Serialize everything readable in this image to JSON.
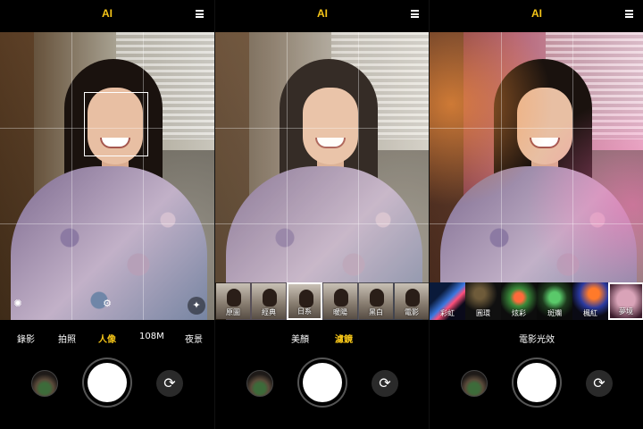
{
  "screens": [
    {
      "ai_label": "AI",
      "menu_icon": "menu-icon",
      "modes": [
        {
          "label": "錄影",
          "active": false
        },
        {
          "label": "拍照",
          "active": false
        },
        {
          "label": "人像",
          "active": true
        },
        {
          "label": "108M",
          "active": false
        },
        {
          "label": "夜景",
          "active": false
        }
      ],
      "icons": [
        "aperture-icon",
        "settings-icon",
        "flash-auto-icon"
      ]
    },
    {
      "ai_label": "AI",
      "menu_icon": "menu-icon",
      "filters": [
        {
          "label": "原圖",
          "selected": false
        },
        {
          "label": "經典",
          "selected": false
        },
        {
          "label": "日系",
          "selected": true
        },
        {
          "label": "暖陽",
          "selected": false
        },
        {
          "label": "黑白",
          "selected": false
        },
        {
          "label": "電影",
          "selected": false
        }
      ],
      "modes": [
        {
          "label": "美顏",
          "active": false
        },
        {
          "label": "濾鏡",
          "active": true
        }
      ]
    },
    {
      "ai_label": "AI",
      "menu_icon": "menu-icon",
      "flares": [
        {
          "label": "彩虹",
          "selected": false
        },
        {
          "label": "圓環",
          "selected": false
        },
        {
          "label": "炫彩",
          "selected": false
        },
        {
          "label": "斑斕",
          "selected": false
        },
        {
          "label": "楓紅",
          "selected": false
        },
        {
          "label": "夢境",
          "selected": true
        }
      ],
      "modes": [
        {
          "label": "電影光效",
          "active": true
        }
      ]
    }
  ],
  "colors": {
    "accent": "#f5c518",
    "background": "#000000"
  }
}
